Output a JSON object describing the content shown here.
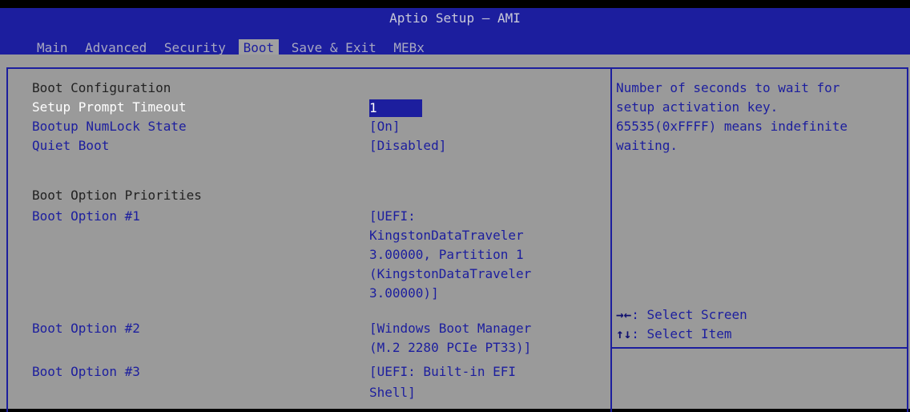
{
  "header": {
    "title": "Aptio Setup – AMI",
    "tabs": [
      "Main",
      "Advanced",
      "Security",
      "Boot",
      "Save & Exit",
      "MEBx"
    ],
    "active_tab": "Boot"
  },
  "boot": {
    "section_title": "Boot Configuration",
    "setup_prompt_timeout": {
      "label": "Setup Prompt Timeout",
      "value": "1"
    },
    "numlock": {
      "label": "Bootup NumLock State",
      "value": "[On]"
    },
    "quiet_boot": {
      "label": "Quiet Boot",
      "value": "[Disabled]"
    },
    "priorities_title": "Boot Option Priorities",
    "option1": {
      "label": "Boot Option #1",
      "value_lines": [
        "[UEFI:",
        "KingstonDataTraveler",
        "3.00000, Partition 1",
        "(KingstonDataTraveler",
        "3.00000)]"
      ]
    },
    "option2": {
      "label": "Boot Option #2",
      "value_lines": [
        "[Windows Boot Manager",
        "(M.2 2280 PCIe PT33)]"
      ]
    },
    "option3": {
      "label": "Boot Option #3",
      "value_lines": [
        "[UEFI: Built-in EFI",
        "Shell]"
      ]
    }
  },
  "help": {
    "lines": [
      "Number of seconds to wait for",
      "setup activation key.",
      "65535(0xFFFF) means indefinite",
      "waiting."
    ]
  },
  "keys": {
    "select_screen": {
      "glyph": "→←",
      "text": ": Select Screen"
    },
    "select_item": {
      "glyph": "↑↓",
      "text": ": Select Item"
    }
  },
  "colors": {
    "bios_blue": "#1c1e9e",
    "panel_gray": "#9a9a9a",
    "selected_white": "#ffffff"
  }
}
